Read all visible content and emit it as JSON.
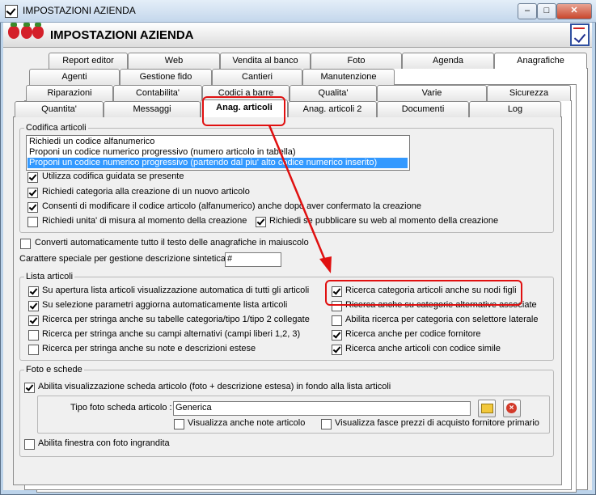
{
  "window": {
    "title": "IMPOSTAZIONI AZIENDA",
    "minimize": "‒",
    "maximize": "□",
    "close": "✕"
  },
  "header": {
    "title": "IMPOSTAZIONI AZIENDA"
  },
  "tabs": {
    "row1": [
      "Report editor",
      "Web",
      "Vendita al banco",
      "Foto",
      "Agenda",
      "Anagrafiche"
    ],
    "row2": [
      "Agenti",
      "Gestione fido",
      "Cantieri",
      "Manutenzione"
    ],
    "row3": [
      "Riparazioni",
      "Contabilita'",
      "Codici a barre",
      "Qualita'",
      "Varie",
      "Sicurezza"
    ],
    "row4": [
      "Quantita'",
      "Messaggi",
      "Anag. articoli",
      "Anag. articoli 2",
      "Documenti",
      "Log"
    ],
    "selected": "Anag. articoli"
  },
  "codifica": {
    "title": "Codifica articoli",
    "options": [
      "Richiedi un codice alfanumerico",
      "Proponi un codice numerico progressivo (numero articolo in tabella)",
      "Proponi un codice numerico progressivo (partendo dal piu' alto codice numerico inserito)"
    ],
    "selected_index": 2,
    "checks": {
      "guidata": "Utilizza codifica guidata se presente",
      "categoria": "Richiedi categoria alla creazione di un nuovo articolo",
      "modifica": "Consenti di modificare il codice articolo (alfanumerico) anche dopo aver confermato la creazione",
      "unita": "Richiedi unita' di misura al momento della creazione",
      "web": "Richiedi se pubblicare su web al momento della creazione"
    }
  },
  "converti": "Converti automaticamente tutto il testo delle anagrafiche in maiuscolo",
  "carattere": {
    "label": "Carattere speciale per gestione descrizione sintetica :",
    "value": "#"
  },
  "lista": {
    "title": "Lista articoli",
    "left": [
      "Su apertura lista articoli visualizzazione automatica di tutti gli articoli",
      "Su selezione parametri aggiorna automaticamente lista articoli",
      "Ricerca per stringa anche su tabelle categoria/tipo 1/tipo 2 collegate",
      "Ricerca per stringa anche su campi alternativi (campi liberi 1,2, 3)",
      "Ricerca per stringa anche su note e descrizioni estese"
    ],
    "right": [
      "Ricerca categoria articoli anche su nodi figli",
      "Ricerca anche su categorie alternative associate",
      "Abilita ricerca per categoria con selettore laterale",
      "Ricerca anche per codice fornitore",
      "Ricerca anche articoli con codice simile"
    ]
  },
  "foto": {
    "title": "Foto e schede",
    "abilita_scheda": "Abilita visualizzazione scheda articolo (foto + descrizione estesa) in fondo alla lista articoli",
    "tipo_label": "Tipo foto scheda articolo :",
    "tipo_value": "Generica",
    "note": "Visualizza anche note articolo",
    "fasce": "Visualizza fasce prezzi di acquisto fornitore primario",
    "finestra": "Abilita finestra con foto ingrandita"
  },
  "colors": {
    "highlight": "#e01010",
    "selection": "#3399ff"
  }
}
